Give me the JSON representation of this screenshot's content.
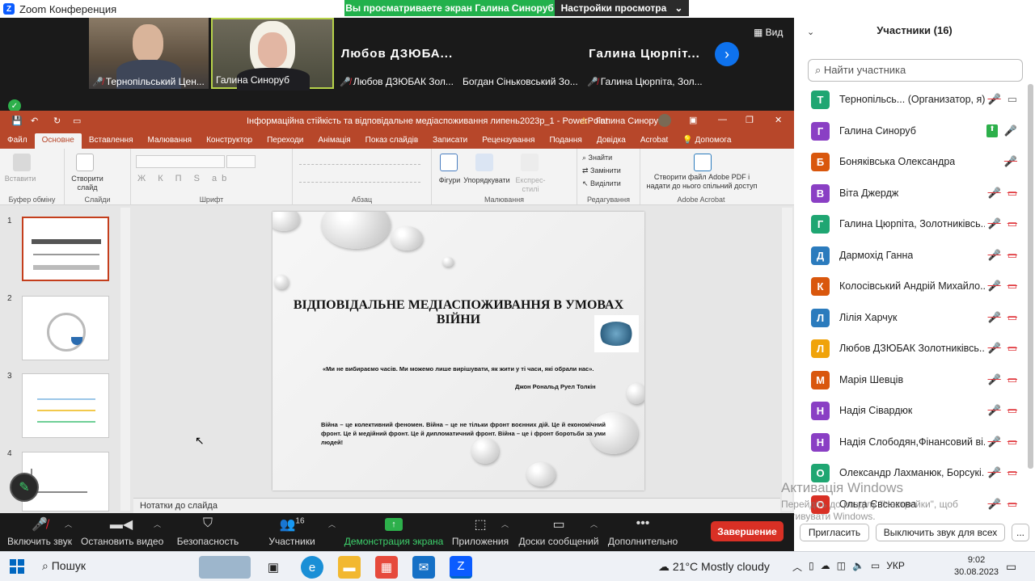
{
  "window": {
    "title": "Zoom Конференция",
    "min": "—",
    "max": "❐",
    "close": "✕"
  },
  "share_banner": {
    "text": "Вы просматриваете экран Галина Синоруб",
    "view_settings": "Настройки просмотра"
  },
  "gallery": {
    "view_label": "Вид",
    "tiles": [
      {
        "name": "Тернопільський Цен..."
      },
      {
        "name": "Галина Синоруб"
      },
      {
        "big": "Любов ДЗЮБА...",
        "name": "Любов ДЗЮБАК Зол..."
      },
      {
        "name": "Богдан Сіньковський Зо..."
      },
      {
        "big": "Галина Цюрпіт...",
        "name": "Галина Цюрпіта, Зол..."
      }
    ]
  },
  "ppt": {
    "doc_title": "Інформаційна стійкість та відповідальне медіаспоживання липень2023р_1  -  PowerPoint",
    "user": "Галина Синоруб",
    "tabs": [
      "Файл",
      "Основне",
      "Вставлення",
      "Малювання",
      "Конструктор",
      "Переходи",
      "Анімація",
      "Показ слайдів",
      "Записати",
      "Рецензування",
      "Подання",
      "Довідка",
      "Acrobat",
      "Допомога"
    ],
    "groups": {
      "clipboard": "Буфер обміну",
      "paste": "Вставити",
      "slides": "Слайди",
      "new_slide": "Створити слайд",
      "font": "Шрифт",
      "paragraph": "Абзац",
      "drawing": "Малювання",
      "shapes": "Фігури",
      "arrange": "Упорядкувати",
      "quick_styles": "Експрес-стилі",
      "editing": "Редагування",
      "find": "Знайти",
      "replace": "Замінити",
      "select": "Виділити",
      "acrobat": "Adobe Acrobat",
      "acrobat_btn": "Створити файл Adobe PDF і надати до нього спільний доступ",
      "font_row": "Ж К П S ab"
    },
    "slide_numbers": [
      "1",
      "2",
      "3",
      "4"
    ],
    "slide": {
      "title": "ВІДПОВІДАЛЬНЕ МЕДІАСПОЖИВАННЯ В УМОВАХ ВІЙНИ",
      "quote": "«Ми не вибираємо часів. Ми можемо лише вирішувати, як жити у ті часи, які обрали нас».",
      "author": "Джон Рональд Руел Толкін",
      "body": "Війна – це колективний феномен. Війна – це не тільки фронт воєнних дій. Це й економічний фронт. Це й медійний фронт. Це й дипломатичний фронт. Війна – це і фронт боротьби за уми людей!"
    },
    "notes": "Нотатки до слайда"
  },
  "toolbar": {
    "audio": "Включить звук",
    "video": "Остановить видео",
    "security": "Безопасность",
    "participants": "Участники",
    "participants_count": "16",
    "share": "Демонстрация экрана",
    "apps": "Приложения",
    "whiteboards": "Доски сообщений",
    "more": "Дополнительно",
    "end": "Завершение"
  },
  "panel": {
    "title": "Участники (16)",
    "search_placeholder": "Найти участника",
    "participants": [
      {
        "initial": "Т",
        "name": "Тернопільсь... (Организатор, я)",
        "color": "#1fa672",
        "mic": "off",
        "cam": "on"
      },
      {
        "initial": "Г",
        "name": "Галина Синоруб",
        "color": "#8a3fc4",
        "mic": "on",
        "cam": "none",
        "share": true
      },
      {
        "initial": "Б",
        "name": "Боняківська Олександра",
        "color": "#d9570d",
        "mic": "off",
        "cam": "none"
      },
      {
        "initial": "В",
        "name": "Віта Джердж",
        "color": "#8a3fc4",
        "mic": "off",
        "cam": "off"
      },
      {
        "initial": "Г",
        "name": "Галина Цюрпіта, Золотниківсь...",
        "color": "#1fa672",
        "mic": "off",
        "cam": "off"
      },
      {
        "initial": "Д",
        "name": "Дармохід Ганна",
        "color": "#2b7bbd",
        "mic": "off",
        "cam": "off"
      },
      {
        "initial": "К",
        "name": "Колосівський Андрій Михайло...",
        "color": "#d9570d",
        "mic": "off",
        "cam": "off"
      },
      {
        "initial": "Л",
        "name": "Лілія Харчук",
        "color": "#2b7bbd",
        "mic": "off",
        "cam": "off"
      },
      {
        "initial": "Л",
        "name": "Любов ДЗЮБАК Золотниківсь...",
        "color": "#f0a30a",
        "mic": "off",
        "cam": "off"
      },
      {
        "initial": "М",
        "name": "Марія Шевців",
        "color": "#d9570d",
        "mic": "off",
        "cam": "off"
      },
      {
        "initial": "Н",
        "name": "Надія Сівардюк",
        "color": "#8a3fc4",
        "mic": "off",
        "cam": "off"
      },
      {
        "initial": "Н",
        "name": "Надія Слободян,Фінансовий ві...",
        "color": "#8a3fc4",
        "mic": "off",
        "cam": "off"
      },
      {
        "initial": "О",
        "name": "Олександр Лахманюк, Борсукі...",
        "color": "#1fa672",
        "mic": "off",
        "cam": "off"
      },
      {
        "initial": "О",
        "name": "Ольга Євсюкова",
        "color": "#d93025",
        "mic": "off",
        "cam": "off"
      }
    ],
    "invite": "Пригласить",
    "mute_all": "Выключить звук для всех",
    "more": "..."
  },
  "watermark": {
    "title": "Активація Windows",
    "sub": "Перейдіть до розділу \"Настройки\", щоб активувати Windows."
  },
  "taskbar": {
    "search": "Пошук",
    "weather": "21°C  Mostly cloudy",
    "lang": "УКР",
    "time": "9:02",
    "date": "30.08.2023"
  }
}
